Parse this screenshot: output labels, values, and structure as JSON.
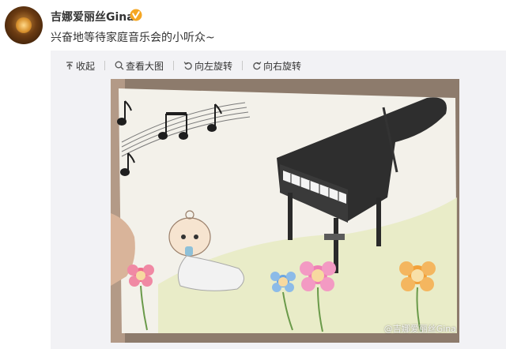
{
  "post": {
    "username": "吉娜爱丽丝Gina",
    "verified_badge_color": "#f5a623",
    "text": "兴奋地等待家庭音乐会的小听众~"
  },
  "toolbar": {
    "collapse_label": "收起",
    "view_large_label": "查看大图",
    "rotate_left_label": "向左旋转",
    "rotate_right_label": "向右旋转"
  },
  "image": {
    "watermark": "@吉娜爱丽丝Gina",
    "description_icons": [
      "music-notes",
      "baby",
      "grand-piano",
      "flowers"
    ]
  }
}
